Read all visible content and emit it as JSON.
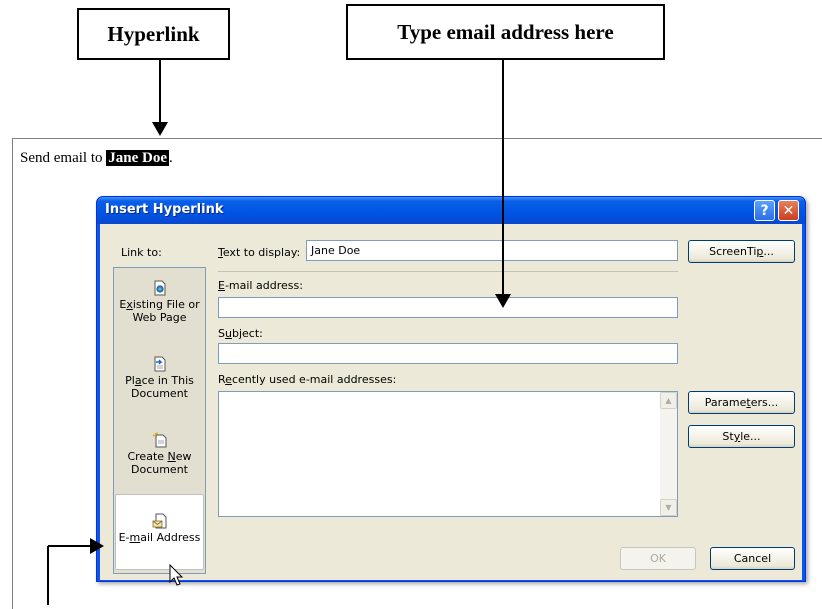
{
  "callouts": {
    "hyperlink": "Hyperlink",
    "email": "Type email address here"
  },
  "document": {
    "text_before": "Send email to ",
    "selected_text": "Jane Doe",
    "text_after": "."
  },
  "dialog": {
    "title": "Insert Hyperlink",
    "help_label": "?",
    "close_label": "✕",
    "link_to_label": "Link to:",
    "link_items": [
      {
        "label_parts": [
          "E",
          "x",
          "isting File or Web Page"
        ],
        "icon": "existing-file-icon"
      },
      {
        "label_parts": [
          "Pl",
          "a",
          "ce in This Document"
        ],
        "icon": "place-in-document-icon"
      },
      {
        "label_parts": [
          "Create ",
          "N",
          "ew Document"
        ],
        "icon": "create-new-document-icon"
      },
      {
        "label_parts": [
          "E-",
          "m",
          "ail Address"
        ],
        "icon": "email-address-icon",
        "active": true
      }
    ],
    "text_to_display": {
      "label_u": "T",
      "label_rest": "ext to display:",
      "value": "Jane Doe"
    },
    "email_address": {
      "label_u": "E",
      "label_rest": "-mail address:",
      "value": ""
    },
    "subject": {
      "label_pre": "S",
      "label_u": "u",
      "label_rest": "bject:",
      "value": ""
    },
    "recent": {
      "label_pre": "R",
      "label_u": "e",
      "label_rest": "cently used e-mail addresses:"
    },
    "buttons": {
      "screentip": {
        "pre": "ScreenTi",
        "u": "p",
        "post": "..."
      },
      "parameters": {
        "pre": "Parame",
        "u": "t",
        "post": "ers..."
      },
      "style": {
        "pre": "St",
        "u": "y",
        "post": "le..."
      },
      "ok": "OK",
      "cancel": "Cancel"
    },
    "scroll_up": "▲",
    "scroll_down": "▼"
  },
  "colors": {
    "title_blue": "#0054e3",
    "dialog_face": "#ece9d8",
    "field_border": "#7f9db9"
  }
}
